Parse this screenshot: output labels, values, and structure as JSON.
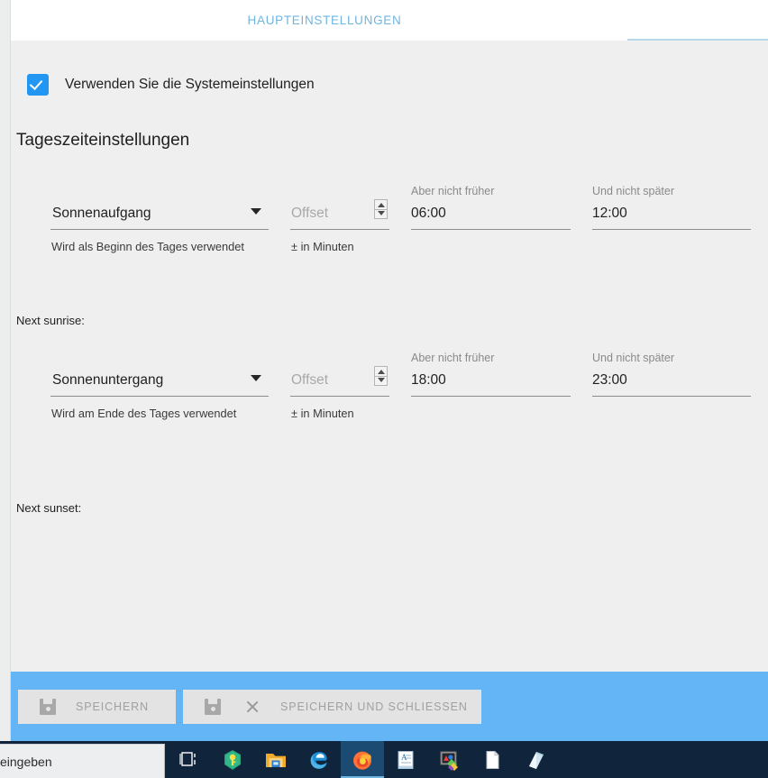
{
  "window": {
    "tab": {
      "active_label": "HAUPTEINSTELLUNGEN",
      "accent_color": "#6fb5e0"
    }
  },
  "main": {
    "system_settings_checkbox": {
      "label": "Verwenden Sie die Systemeinstellungen",
      "checked": true,
      "color": "#2196f3"
    },
    "section_title": "Tageszeiteinstellungen",
    "rows": [
      {
        "select": {
          "value": "Sonnenaufgang",
          "hint": "Wird als Beginn des Tages verwendet"
        },
        "offset": {
          "placeholder": "Offset",
          "value": "",
          "hint": "± in Minuten"
        },
        "not_earlier": {
          "caption": "Aber nicht früher",
          "value": "06:00"
        },
        "not_later": {
          "caption": "Und nicht später",
          "value": "12:00"
        },
        "next_label": "Next sunrise:"
      },
      {
        "select": {
          "value": "Sonnenuntergang",
          "hint": "Wird am Ende des Tages verwendet"
        },
        "offset": {
          "placeholder": "Offset",
          "value": "",
          "hint": "± in Minuten"
        },
        "not_earlier": {
          "caption": "Aber nicht früher",
          "value": "18:00"
        },
        "not_later": {
          "caption": "Und nicht später",
          "value": "23:00"
        },
        "next_label": "Next sunset:"
      }
    ]
  },
  "actionbar": {
    "background_color": "#64b5f5",
    "save_label": "SPEICHERN",
    "save_close_label": "SPEICHERN UND SCHLIESSEN"
  },
  "taskbar": {
    "search_text": "eingeben",
    "items": [
      {
        "name": "task-view-icon"
      },
      {
        "name": "keepass-icon"
      },
      {
        "name": "file-explorer-icon"
      },
      {
        "name": "edge-icon"
      },
      {
        "name": "firefox-icon",
        "active": true
      },
      {
        "name": "wordpad-icon"
      },
      {
        "name": "paint-icon"
      },
      {
        "name": "document-icon"
      },
      {
        "name": "sticky-notes-icon"
      }
    ]
  }
}
